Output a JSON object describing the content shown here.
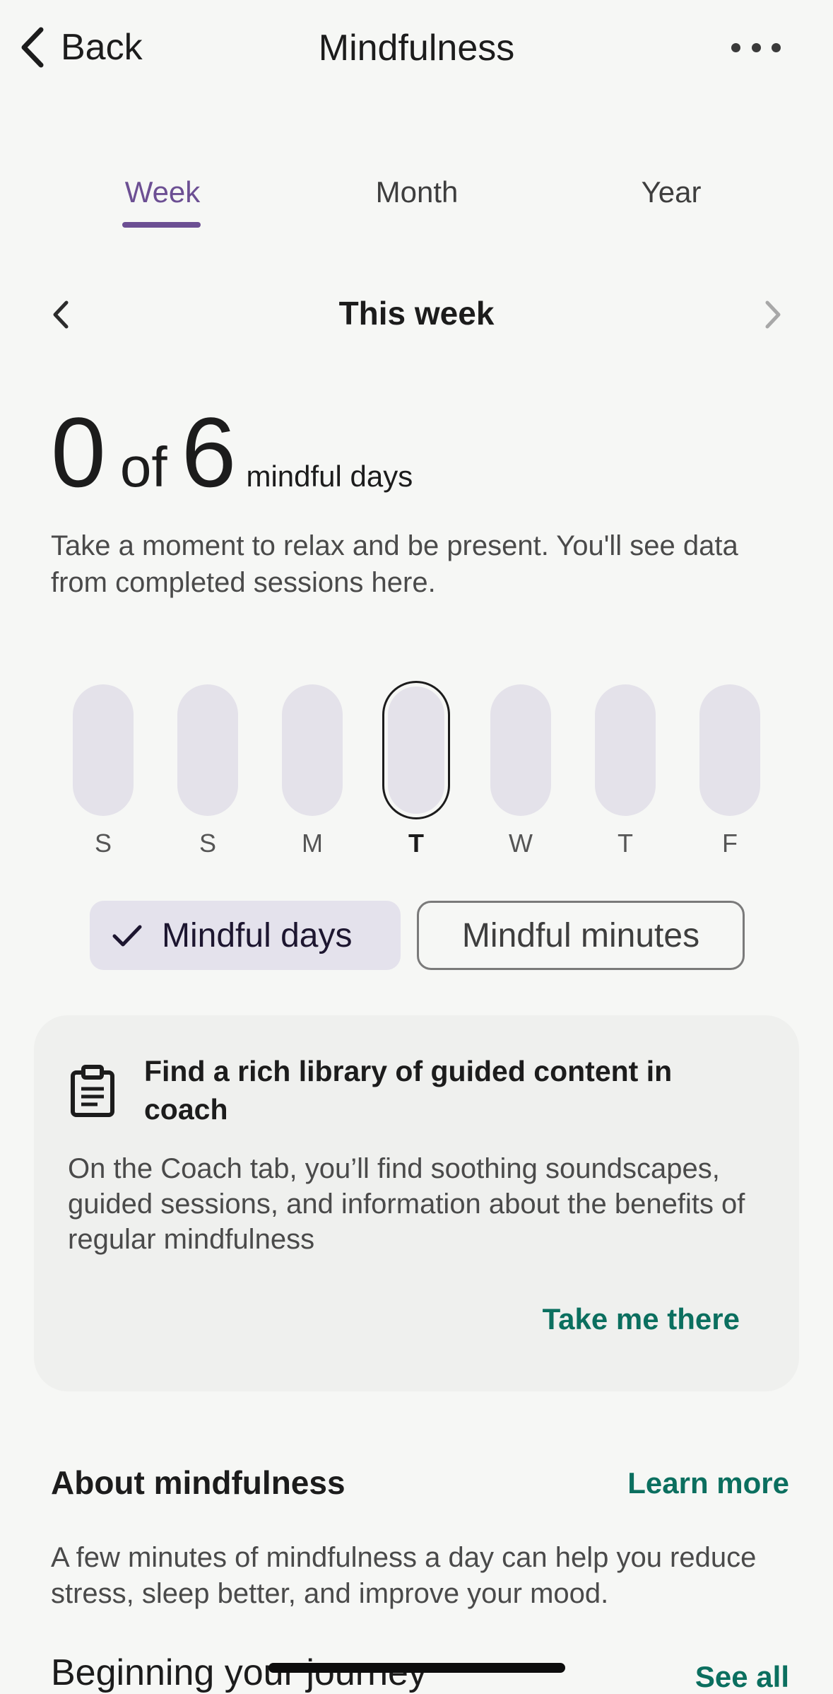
{
  "header": {
    "back_label": "Back",
    "title": "Mindfulness",
    "more_icon": "more-horizontal-icon"
  },
  "tabs": [
    {
      "label": "Week",
      "active": true
    },
    {
      "label": "Month",
      "active": false
    },
    {
      "label": "Year",
      "active": false
    }
  ],
  "week_nav": {
    "title": "This week",
    "prev_icon": "chevron-left-icon",
    "next_icon": "chevron-right-icon",
    "next_enabled": false
  },
  "summary": {
    "count": "0",
    "of_word": "of",
    "total": "6",
    "unit": "mindful days",
    "description": "Take a moment to relax and be present. You'll see data from completed sessions here."
  },
  "days": [
    {
      "label": "S",
      "selected": false
    },
    {
      "label": "S",
      "selected": false
    },
    {
      "label": "M",
      "selected": false
    },
    {
      "label": "T",
      "selected": true
    },
    {
      "label": "W",
      "selected": false
    },
    {
      "label": "T",
      "selected": false
    },
    {
      "label": "F",
      "selected": false
    }
  ],
  "chips": {
    "mindful_days": "Mindful days",
    "mindful_minutes": "Mindful minutes",
    "selected": "mindful_days"
  },
  "coach_card": {
    "icon": "clipboard-icon",
    "title": "Find a rich library of guided content in coach",
    "body": "On the Coach tab, you’ll find soothing soundscapes, guided sessions, and information about the benefits of regular mindfulness",
    "link": "Take me there"
  },
  "about": {
    "title": "About mindfulness",
    "link": "Learn more",
    "body": "A few minutes of mindfulness a day can help you reduce stress, sleep better, and improve your mood."
  },
  "journey": {
    "title": "Beginning your journey",
    "link": "See all"
  },
  "colors": {
    "accent_purple": "#6c4f93",
    "link_green": "#0b6f5f",
    "pill_fill": "#e4e2ea",
    "background": "#f6f7f5"
  }
}
